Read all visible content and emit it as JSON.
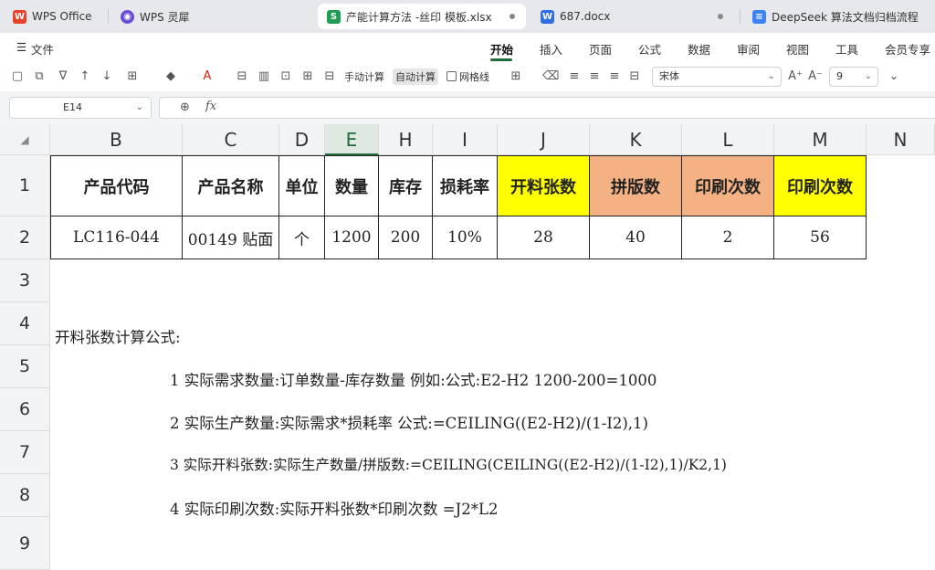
{
  "tabs": [
    {
      "label": "WPS Office",
      "icon": "wps-icon",
      "color": "#e8412c"
    },
    {
      "label": "WPS 灵犀",
      "icon": "lingxi-icon",
      "color": "#6a4bd6"
    },
    {
      "label": "产能计算方法 -丝印 模板.xlsx",
      "icon": "S",
      "color": "#1f9d55"
    },
    {
      "label": "687.docx",
      "icon": "W",
      "color": "#2f6de0"
    },
    {
      "label": "DeepSeek 算法文档归档流程",
      "icon": "doc-icon",
      "color": "#3b82f6"
    }
  ],
  "menu": {
    "file": "文件",
    "items": [
      "开始",
      "插入",
      "页面",
      "公式",
      "数据",
      "审阅",
      "视图",
      "工具",
      "会员专享"
    ]
  },
  "toolbar": {
    "manual_calc": "手动计算",
    "auto_calc": "自动计算",
    "gridlines": "网格线",
    "font": "宋体",
    "font_size": "9"
  },
  "formula_bar": {
    "cell_ref": "E14",
    "fx": "fx",
    "value": ""
  },
  "columns": [
    "B",
    "C",
    "D",
    "E",
    "H",
    "I",
    "J",
    "K",
    "L",
    "M",
    "N"
  ],
  "rows": [
    "1",
    "2",
    "3",
    "4",
    "5",
    "6",
    "7",
    "8",
    "9"
  ],
  "table": {
    "headers": [
      "产品代码",
      "产品名称",
      "单位",
      "数量",
      "库存",
      "损耗率",
      "开料张数",
      "拼版数",
      "印刷次数",
      "印刷次数"
    ],
    "row": [
      "LC116-044",
      "00149 贴面",
      "个",
      "1200",
      "200",
      "10%",
      "28",
      "40",
      "2",
      "56"
    ]
  },
  "notes": {
    "title": "开料张数计算公式:",
    "lines": [
      "1 实际需求数量:订单数量-库存数量  例如:公式:E2-H2 1200-200=1000",
      "2 实际生产数量:实际需求*损耗率 公式:=CEILING((E2-H2)/(1-I2),1)",
      "3 实际开料张数:实际生产数量/拼版数:=CEILING(CEILING((E2-H2)/(1-I2),1)/K2,1)",
      "4 实际印刷次数:实际开料张数*印刷次数 =J2*L2"
    ]
  },
  "colors": {
    "yellow": "#ffff00",
    "orange": "#f4b183",
    "accent": "#1e6d3a"
  }
}
